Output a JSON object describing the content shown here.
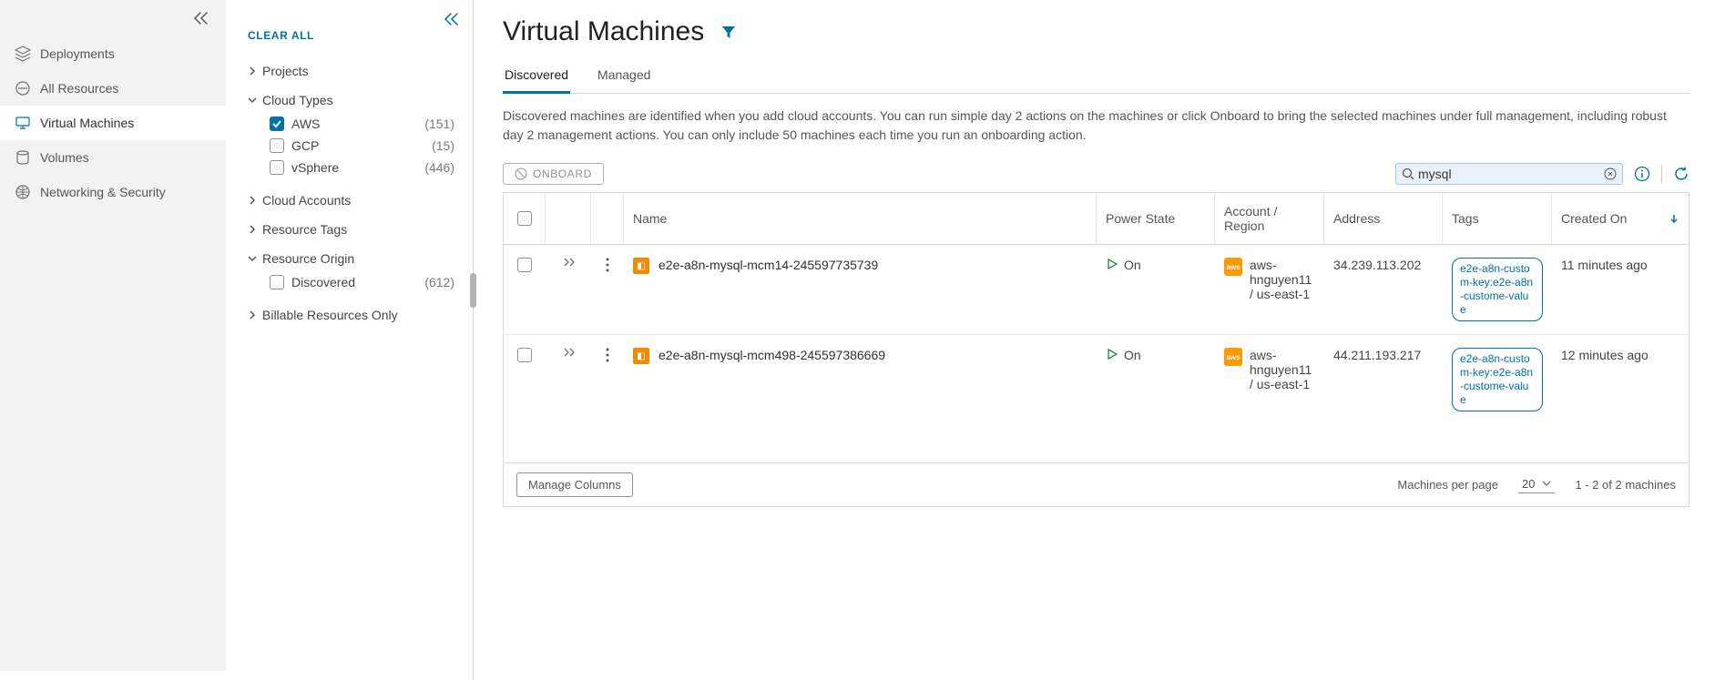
{
  "sidebar": {
    "items": [
      {
        "label": "Deployments"
      },
      {
        "label": "All Resources"
      },
      {
        "label": "Virtual Machines"
      },
      {
        "label": "Volumes"
      },
      {
        "label": "Networking & Security"
      }
    ]
  },
  "filters": {
    "clear_all": "CLEAR ALL",
    "sections": {
      "projects": {
        "label": "Projects"
      },
      "cloud_types": {
        "label": "Cloud Types",
        "options": [
          {
            "label": "AWS",
            "count": "(151)",
            "checked": true
          },
          {
            "label": "GCP",
            "count": "(15)",
            "checked": false
          },
          {
            "label": "vSphere",
            "count": "(446)",
            "checked": false
          }
        ]
      },
      "cloud_accounts": {
        "label": "Cloud Accounts"
      },
      "resource_tags": {
        "label": "Resource Tags"
      },
      "resource_origin": {
        "label": "Resource Origin",
        "options": [
          {
            "label": "Discovered",
            "count": "(612)",
            "checked": false
          }
        ]
      },
      "billable": {
        "label": "Billable Resources Only"
      }
    }
  },
  "page": {
    "title": "Virtual Machines",
    "tabs": [
      {
        "label": "Discovered",
        "active": true
      },
      {
        "label": "Managed",
        "active": false
      }
    ],
    "description": "Discovered machines are identified when you add cloud accounts. You can run simple day 2 actions on the machines or click Onboard to bring the selected machines under full management, including robust day 2 management actions. You can only include 50 machines each time you run an onboarding action.",
    "onboard_label": "ONBOARD",
    "search_value": "mysql",
    "columns": {
      "name": "Name",
      "power": "Power State",
      "account": "Account / Region",
      "address": "Address",
      "tags": "Tags",
      "created": "Created On"
    },
    "rows": [
      {
        "name": "e2e-a8n-mysql-mcm14-245597735739",
        "power": "On",
        "account": "aws-hnguyen11 / us-east-1",
        "address": "34.239.113.202",
        "tag": "e2e-a8n-custom-key:e2e-a8n-custome-value",
        "created": "11 minutes ago"
      },
      {
        "name": "e2e-a8n-mysql-mcm498-245597386669",
        "power": "On",
        "account": "aws-hnguyen11 / us-east-1",
        "address": "44.211.193.217",
        "tag": "e2e-a8n-custom-key:e2e-a8n-custome-value",
        "created": "12 minutes ago"
      }
    ],
    "footer": {
      "manage_columns": "Manage Columns",
      "per_page_label": "Machines per page",
      "per_page_value": "20",
      "range": "1 - 2 of 2 machines"
    }
  }
}
